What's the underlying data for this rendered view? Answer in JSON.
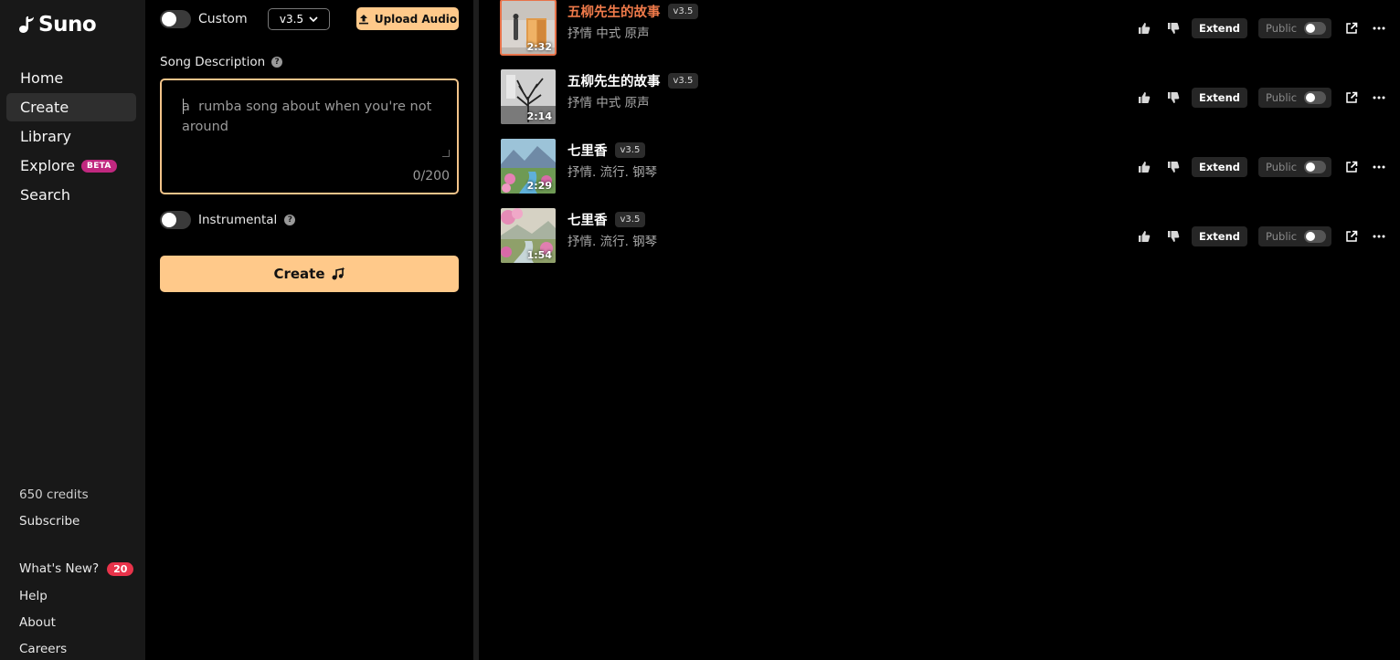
{
  "brand": {
    "name": "Suno"
  },
  "sidebar": {
    "items": [
      {
        "label": "Home"
      },
      {
        "label": "Create"
      },
      {
        "label": "Library"
      },
      {
        "label": "Explore",
        "badge": "BETA"
      },
      {
        "label": "Search"
      }
    ],
    "credits": "650 credits",
    "subscribe": "Subscribe",
    "whats_new": "What's New?",
    "whats_new_count": "20",
    "help": "Help",
    "about": "About",
    "careers": "Careers"
  },
  "create_panel": {
    "custom_label": "Custom",
    "custom_enabled": false,
    "version": "v3.5",
    "upload_label": "Upload Audio",
    "description_label": "Song Description",
    "description_value": "",
    "description_placeholder": "a  rumba song about when you're not around",
    "char_count": "0/200",
    "instrumental_label": "Instrumental",
    "instrumental_enabled": false,
    "create_label": "Create"
  },
  "songs": [
    {
      "title": "五柳先生的故事",
      "version": "v3.5",
      "tags": "抒情 中式 原声",
      "duration": "2:32",
      "current": true,
      "extend": "Extend",
      "public": "Public"
    },
    {
      "title": "五柳先生的故事",
      "version": "v3.5",
      "tags": "抒情 中式 原声",
      "duration": "2:14",
      "current": false,
      "extend": "Extend",
      "public": "Public"
    },
    {
      "title": "七里香",
      "version": "v3.5",
      "tags": "抒情. 流行. 钢琴",
      "duration": "2:29",
      "current": false,
      "extend": "Extend",
      "public": "Public"
    },
    {
      "title": "七里香",
      "version": "v3.5",
      "tags": "抒情. 流行. 钢琴",
      "duration": "1:54",
      "current": false,
      "extend": "Extend",
      "public": "Public"
    }
  ],
  "colors": {
    "accent": "#ffc98a",
    "current_title": "#ef7a4a",
    "sidebar_bg": "#181818",
    "badge_beta": "#c0287f",
    "badge_news": "#e8334a"
  }
}
